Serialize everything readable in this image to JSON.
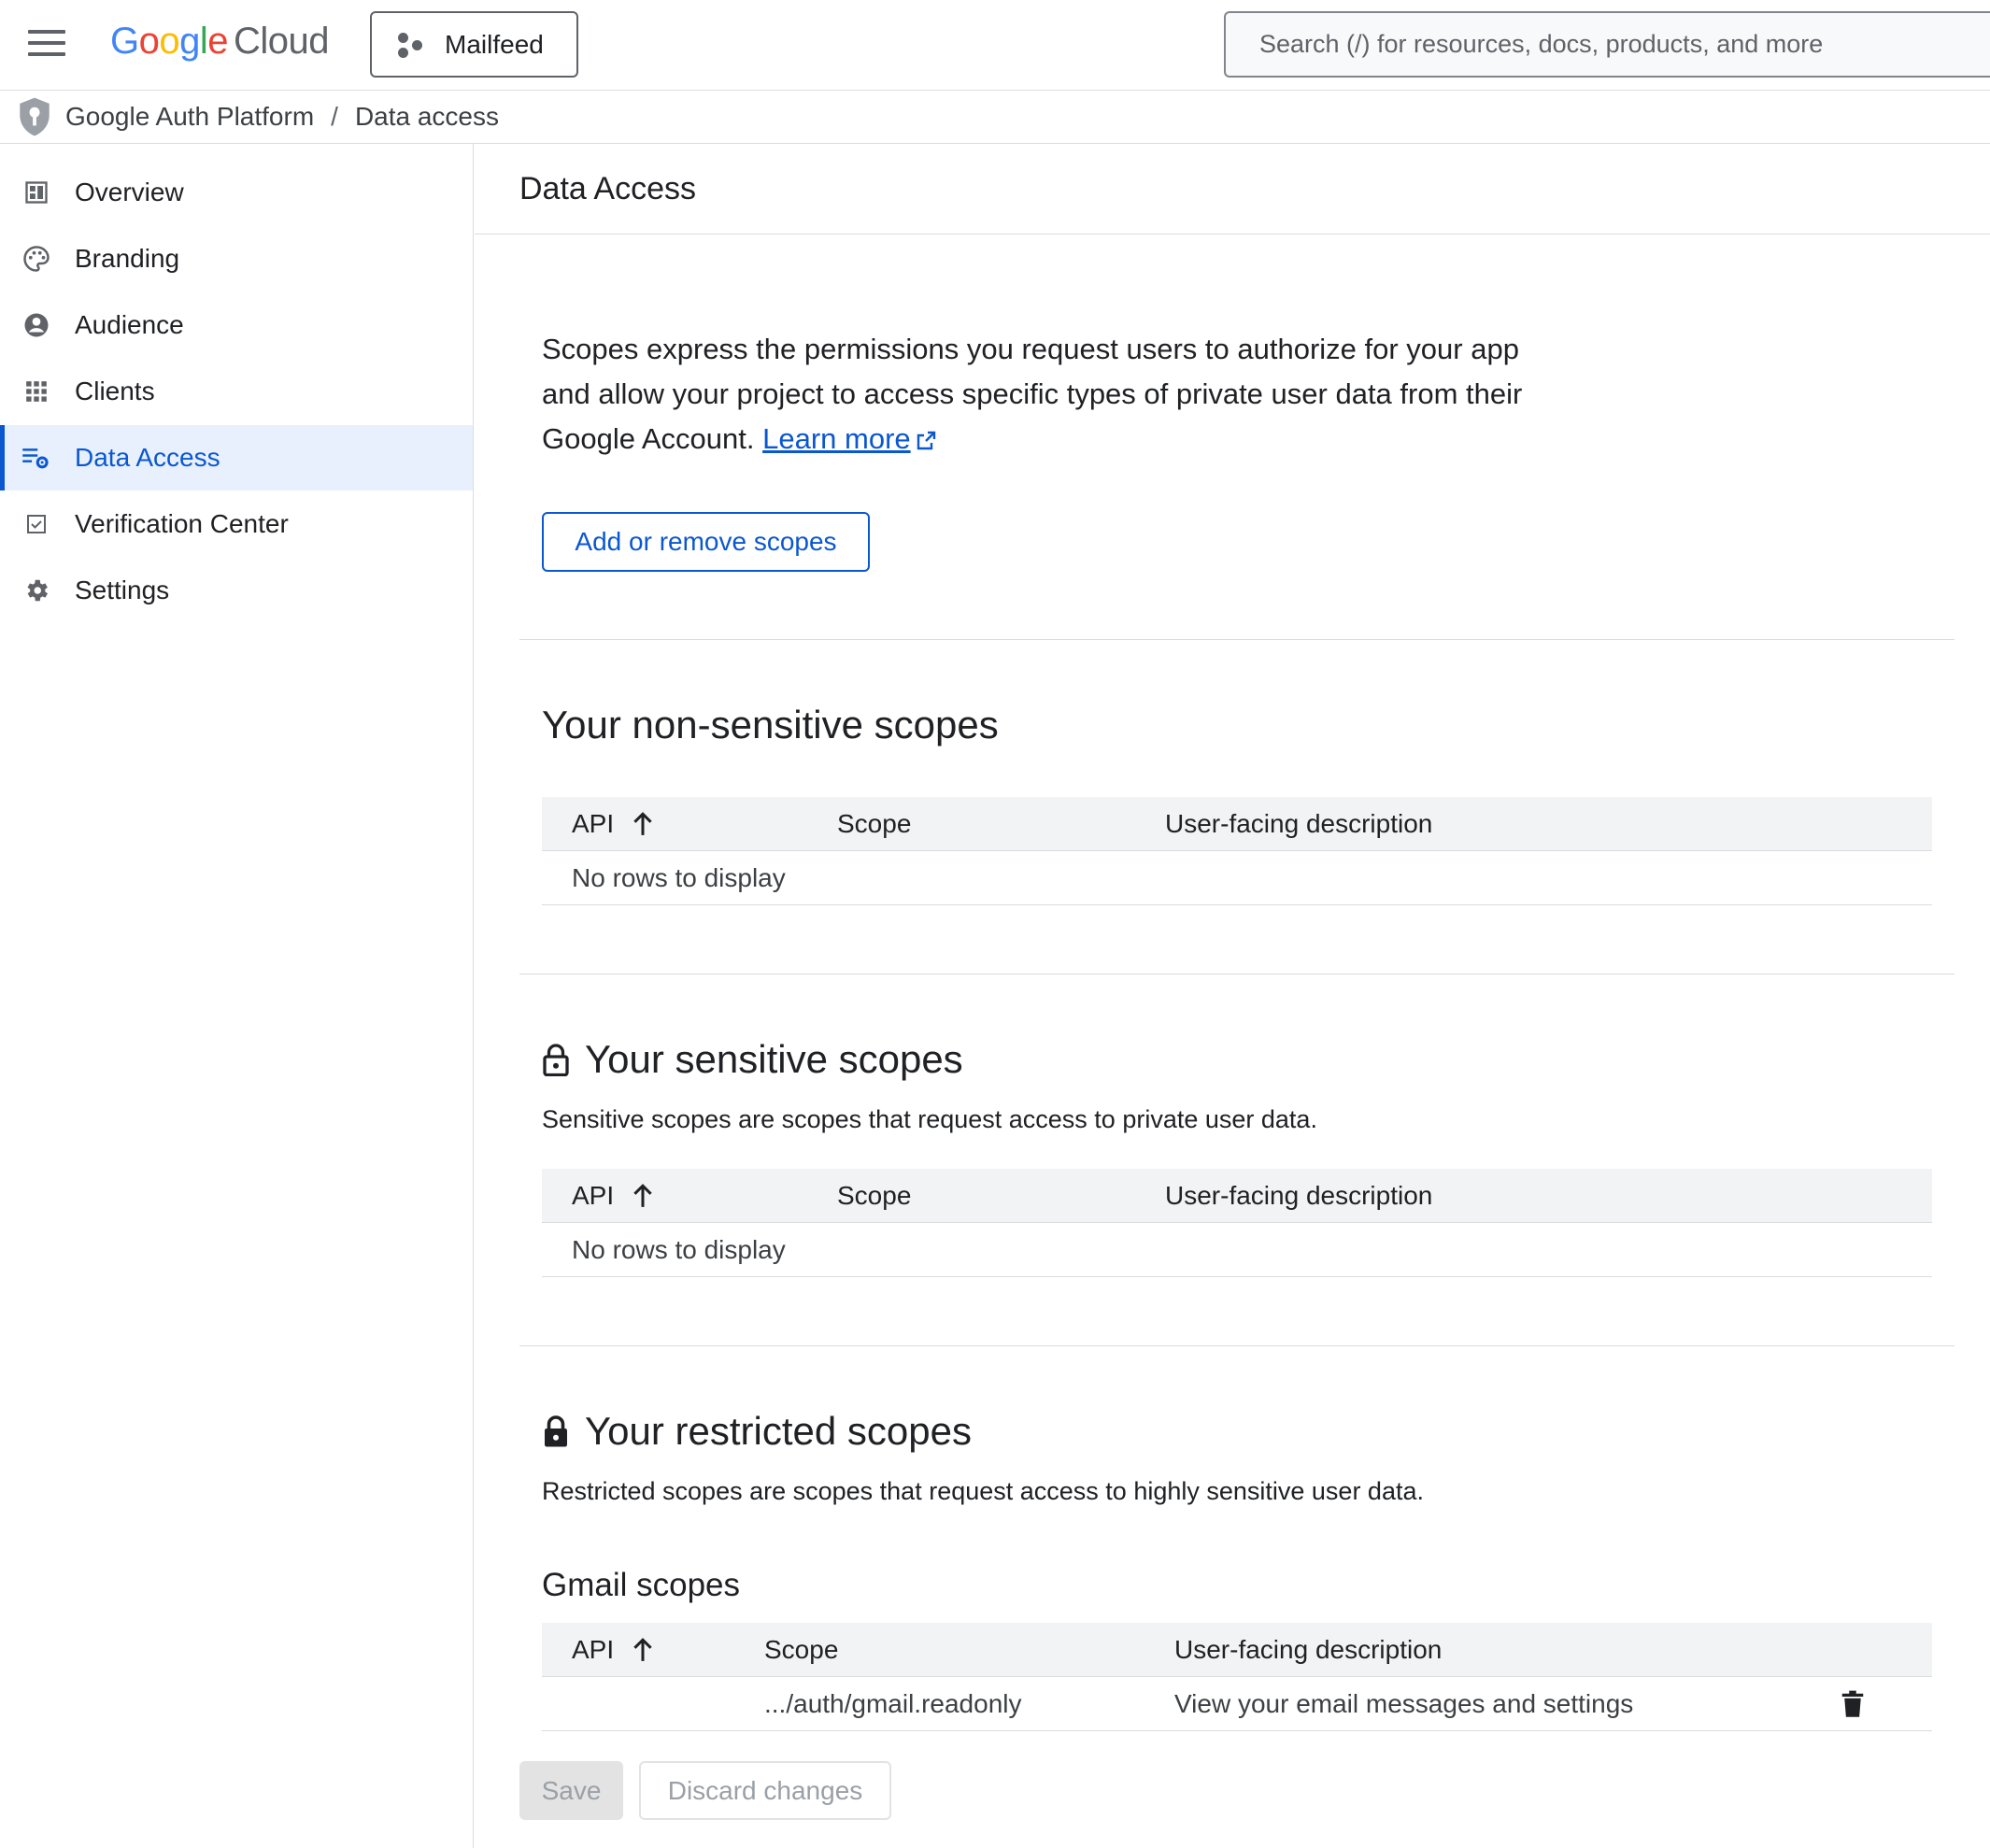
{
  "header": {
    "logo_google": [
      "G",
      "o",
      "o",
      "g",
      "l",
      "e"
    ],
    "logo_cloud": "Cloud",
    "project_name": "Mailfeed",
    "search_placeholder": "Search (/) for resources, docs, products, and more"
  },
  "breadcrumb": {
    "root": "Google Auth Platform",
    "separator": "/",
    "current": "Data access"
  },
  "sidebar": {
    "items": [
      {
        "label": "Overview",
        "icon": "dashboard-icon",
        "active": false
      },
      {
        "label": "Branding",
        "icon": "palette-icon",
        "active": false
      },
      {
        "label": "Audience",
        "icon": "account-circle-icon",
        "active": false
      },
      {
        "label": "Clients",
        "icon": "apps-grid-icon",
        "active": false
      },
      {
        "label": "Data Access",
        "icon": "data-settings-icon",
        "active": true
      },
      {
        "label": "Verification Center",
        "icon": "checkbox-icon",
        "active": false
      },
      {
        "label": "Settings",
        "icon": "gear-icon",
        "active": false
      }
    ]
  },
  "main": {
    "title": "Data Access",
    "intro_text": "Scopes express the permissions you request users to authorize for your app and allow your project to access specific types of private user data from their Google Account. ",
    "learn_more": "Learn more",
    "add_scopes_button": "Add or remove scopes",
    "non_sensitive": {
      "title": "Your non-sensitive scopes",
      "columns": [
        "API",
        "Scope",
        "User-facing description"
      ],
      "empty_text": "No rows to display"
    },
    "sensitive": {
      "title": "Your sensitive scopes",
      "description": "Sensitive scopes are scopes that request access to private user data.",
      "columns": [
        "API",
        "Scope",
        "User-facing description"
      ],
      "empty_text": "No rows to display"
    },
    "restricted": {
      "title": "Your restricted scopes",
      "description": "Restricted scopes are scopes that request access to highly sensitive user data.",
      "gmail_title": "Gmail scopes",
      "columns": [
        "API",
        "Scope",
        "User-facing description"
      ],
      "rows": [
        {
          "api": "",
          "scope": ".../auth/gmail.readonly",
          "description": "View your email messages and settings"
        }
      ]
    },
    "save_button": "Save",
    "discard_button": "Discard changes"
  },
  "colors": {
    "accent": "#0b57d0",
    "active_nav_bg": "#e8f0fe",
    "table_header_bg": "#f1f3f4",
    "divider": "#dadce0"
  }
}
